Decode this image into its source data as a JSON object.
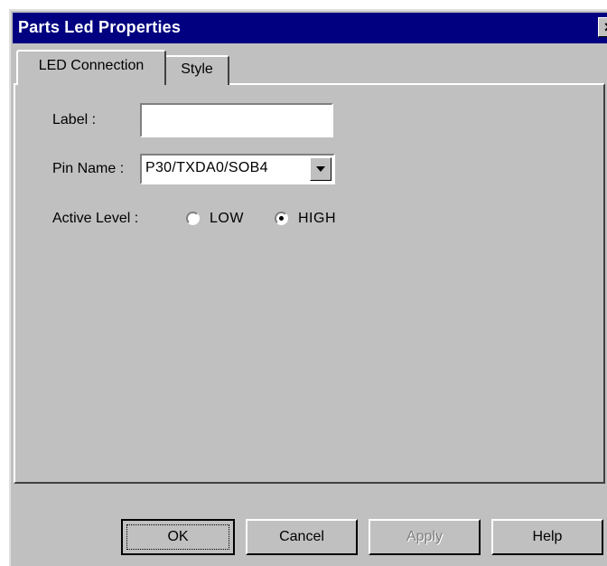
{
  "window": {
    "title": "Parts Led Properties",
    "close_glyph": "×"
  },
  "tabs": [
    {
      "label": "LED Connection",
      "active": true
    },
    {
      "label": "Style",
      "active": false
    }
  ],
  "form": {
    "label_caption": "Label :",
    "label_value": "",
    "pin_caption": "Pin Name :",
    "pin_value": "P30/TXDA0/SOB4",
    "active_level_caption": "Active Level :",
    "active_level_options": [
      {
        "label": "LOW",
        "checked": false
      },
      {
        "label": "HIGH",
        "checked": true
      }
    ]
  },
  "buttons": {
    "ok": "OK",
    "cancel": "Cancel",
    "apply": "Apply",
    "help": "Help"
  },
  "colors": {
    "titlebar": "#000080",
    "face": "#c0c0c0"
  }
}
